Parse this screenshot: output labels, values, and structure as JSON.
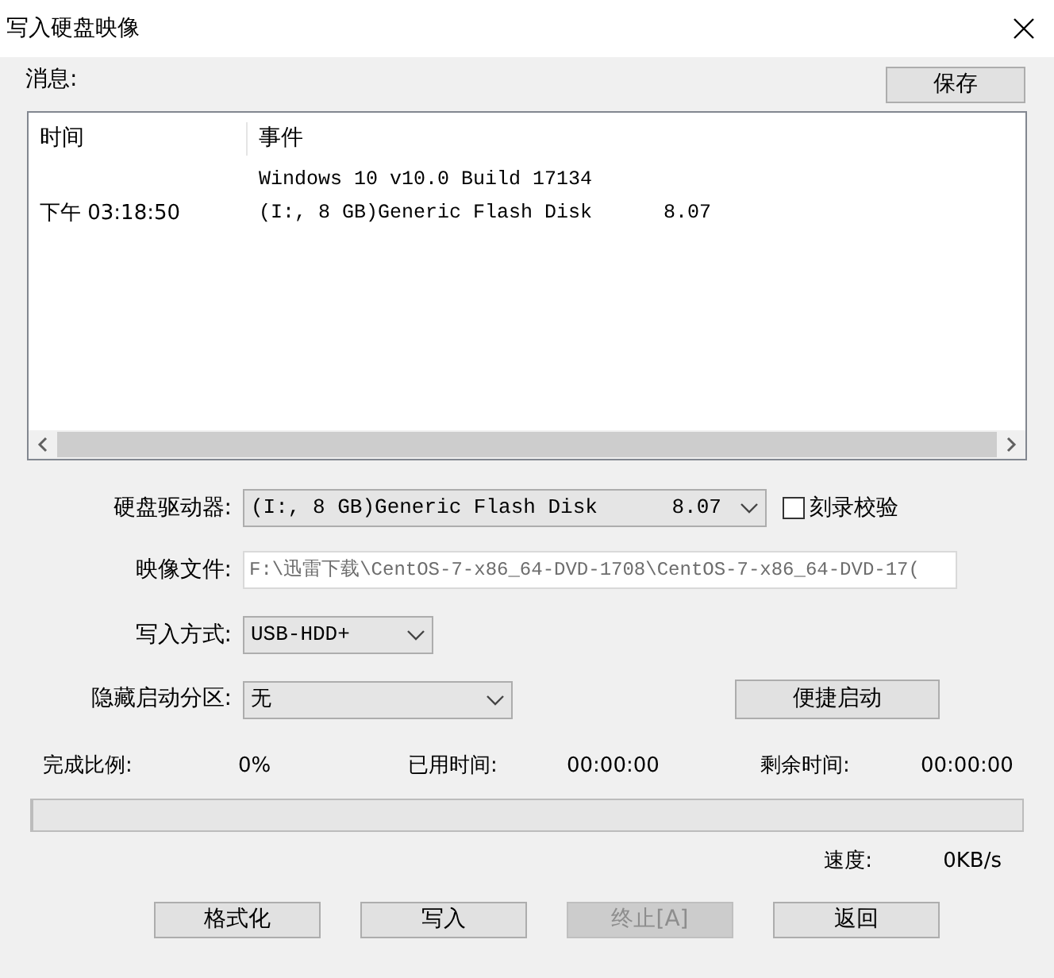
{
  "window": {
    "title": "写入硬盘映像"
  },
  "messages": {
    "label": "消息:",
    "save_button": "保存",
    "columns": [
      "时间",
      "事件"
    ],
    "rows": [
      {
        "time": "",
        "event": "Windows 10 v10.0 Build 17134"
      },
      {
        "time": "下午 03:18:50",
        "event": "(I:, 8 GB)Generic Flash Disk      8.07"
      }
    ]
  },
  "form": {
    "drive": {
      "label": "硬盘驱动器:",
      "value": "(I:, 8 GB)Generic Flash Disk      8.07"
    },
    "verify": {
      "label": "刻录校验",
      "checked": false
    },
    "image_file": {
      "label": "映像文件:",
      "value": "F:\\迅雷下载\\CentOS-7-x86_64-DVD-1708\\CentOS-7-x86_64-DVD-17("
    },
    "write_mode": {
      "label": "写入方式:",
      "value": "USB-HDD+"
    },
    "hidden_partition": {
      "label": "隐藏启动分区:",
      "value": "无"
    },
    "quick_boot_button": "便捷启动"
  },
  "progress": {
    "percent_label": "完成比例:",
    "percent": "0%",
    "elapsed_label": "已用时间:",
    "elapsed": "00:00:00",
    "remaining_label": "剩余时间:",
    "remaining": "00:00:00",
    "level": 0,
    "speed_label": "速度:",
    "speed": "0KB/s"
  },
  "buttons": [
    {
      "label": "格式化",
      "disabled": false
    },
    {
      "label": "写入",
      "disabled": false
    },
    {
      "label": "终止[A]",
      "disabled": true
    },
    {
      "label": "返回",
      "disabled": false
    }
  ]
}
